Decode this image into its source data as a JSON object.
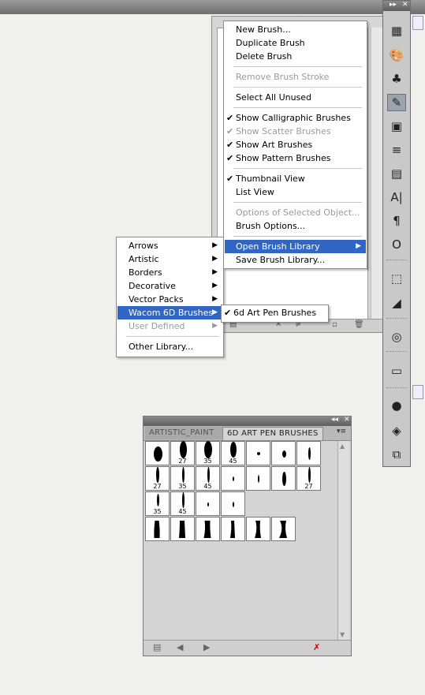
{
  "brush_menu": {
    "items": [
      {
        "label": "New Brush...",
        "checked": false,
        "disabled": false
      },
      {
        "label": "Duplicate Brush",
        "checked": false,
        "disabled": false
      },
      {
        "label": "Delete Brush",
        "checked": false,
        "disabled": false
      },
      {
        "label": "Remove Brush Stroke",
        "checked": false,
        "disabled": true
      },
      {
        "label": "Select All Unused",
        "checked": false,
        "disabled": false
      },
      {
        "label": "Show Calligraphic Brushes",
        "checked": true,
        "disabled": false
      },
      {
        "label": "Show Scatter Brushes",
        "checked": true,
        "disabled": true
      },
      {
        "label": "Show Art Brushes",
        "checked": true,
        "disabled": false
      },
      {
        "label": "Show Pattern Brushes",
        "checked": true,
        "disabled": false
      },
      {
        "label": "Thumbnail View",
        "checked": true,
        "disabled": false
      },
      {
        "label": "List View",
        "checked": false,
        "disabled": false
      },
      {
        "label": "Options of Selected Object...",
        "checked": false,
        "disabled": true
      },
      {
        "label": "Brush Options...",
        "checked": false,
        "disabled": false
      },
      {
        "label": "Open Brush Library",
        "checked": false,
        "disabled": false,
        "selected": true,
        "submenu": true
      },
      {
        "label": "Save Brush Library...",
        "checked": false,
        "disabled": false
      }
    ]
  },
  "library_menu": {
    "items": [
      {
        "label": "Arrows",
        "submenu": true
      },
      {
        "label": "Artistic",
        "submenu": true
      },
      {
        "label": "Borders",
        "submenu": true
      },
      {
        "label": "Decorative",
        "submenu": true
      },
      {
        "label": "Vector Packs",
        "submenu": true
      },
      {
        "label": "Wacom 6D Brushes",
        "submenu": true,
        "selected": true
      },
      {
        "label": "User Defined",
        "submenu": true,
        "disabled": true
      },
      {
        "label": "Other Library..."
      }
    ]
  },
  "wacom_menu": {
    "items": [
      {
        "label": "6d Art Pen Brushes",
        "checked": true
      }
    ]
  },
  "art_panel": {
    "tabs": [
      {
        "label": "ARTISTIC_PAINT",
        "active": false
      },
      {
        "label": "6D ART PEN BRUSHES",
        "active": true
      }
    ],
    "brush_rows": [
      [
        "",
        "27",
        "35",
        "45",
        "",
        "",
        ""
      ],
      [
        "27",
        "35",
        "45",
        "",
        "",
        "",
        "27"
      ],
      [
        "35",
        "45",
        "",
        ""
      ]
    ]
  },
  "toolstrip": {
    "icons": [
      "swatches-icon",
      "palette-icon",
      "symbols-icon",
      "brushes-icon",
      "pathfinder-icon",
      "stroke-icon",
      "align-icon",
      "character-icon",
      "paragraph-icon",
      "opentype-icon",
      "transform-icon",
      "gradient-icon",
      "transparency-icon",
      "color-guide-icon",
      "appearance-icon",
      "layers-icon",
      "artboards-icon"
    ],
    "glyphs": [
      "▦",
      "🎨",
      "♣",
      "✎",
      "▣",
      "≡",
      "▤",
      "A|",
      "¶",
      "O",
      "⬚",
      "◢",
      "◎",
      "▭",
      "●",
      "◈",
      "⧉"
    ]
  }
}
